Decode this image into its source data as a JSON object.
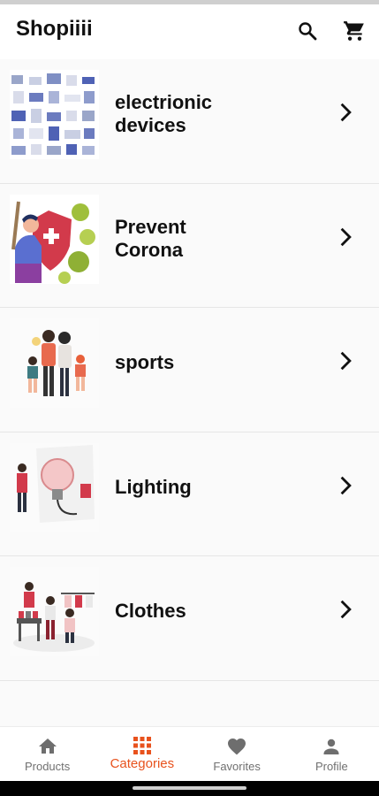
{
  "app": {
    "title": "Shopiiii"
  },
  "appbar": {
    "search_icon": "search-icon",
    "cart_icon": "shopping-cart-icon"
  },
  "categories": [
    {
      "label": "electrionic\ndevices",
      "image": "electronic-devices-illustration"
    },
    {
      "label": "Prevent\nCorona",
      "image": "virus-shield-illustration"
    },
    {
      "label": "sports",
      "image": "family-sports-illustration"
    },
    {
      "label": "Lighting",
      "image": "light-bulb-illustration"
    },
    {
      "label": "Clothes",
      "image": "clothing-store-illustration"
    }
  ],
  "bottom_nav": [
    {
      "label": "Products",
      "icon": "home-icon",
      "active": false
    },
    {
      "label": "Categories",
      "icon": "grid-icon",
      "active": true
    },
    {
      "label": "Favorites",
      "icon": "heart-icon",
      "active": false
    },
    {
      "label": "Profile",
      "icon": "person-icon",
      "active": false
    }
  ],
  "colors": {
    "accent": "#e8521d",
    "inactive": "#707070",
    "text": "#111111"
  }
}
